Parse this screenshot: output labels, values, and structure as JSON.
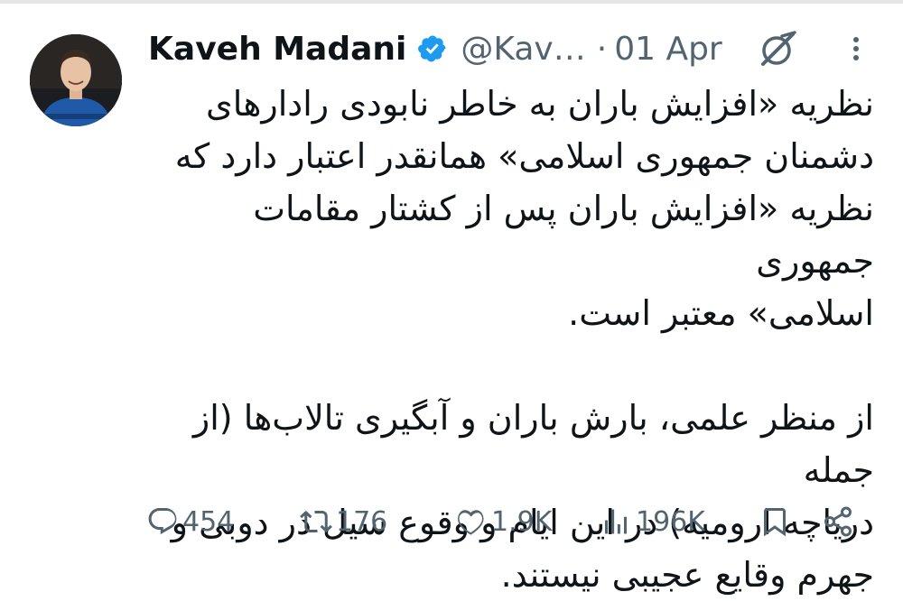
{
  "tweet": {
    "author_name": "Kaveh Madani",
    "handle": "@Kav…",
    "separator": "·",
    "date": "01 Apr",
    "avatar_icon": "profile-photo",
    "verified_icon": "verified-badge-icon",
    "grok_icon": "grok-icon",
    "more_icon": "more-options-icon",
    "colors": {
      "verified": "#1d9bf0",
      "text": "#0f1419",
      "muted": "#536471"
    },
    "paragraphs": [
      [
        "نظریه «افزایش باران به خاطر نابودی رادارهای",
        "دشمنان جمهوری اسلامی» همانقدر اعتبار دارد که",
        "نظریه «افزایش باران پس از کشتار مقامات جمهوری",
        "اسلامی» معتبر است."
      ],
      [
        "از منظر علمی، بارش باران و آبگیری تالاب‌ها (از جمله",
        "دریاچه ارومیه) در این ایام و وقوع سیل در دوبی و",
        "جهرم وقایع عجیبی نیستند."
      ]
    ]
  },
  "actions": {
    "replies": {
      "icon": "reply-icon",
      "count": "454"
    },
    "reposts": {
      "icon": "repost-icon",
      "count": "176"
    },
    "likes": {
      "icon": "heart-icon",
      "count": "1.9K"
    },
    "views": {
      "icon": "views-icon",
      "count": "196K"
    },
    "bookmark": {
      "icon": "bookmark-icon"
    },
    "share": {
      "icon": "share-icon"
    }
  }
}
